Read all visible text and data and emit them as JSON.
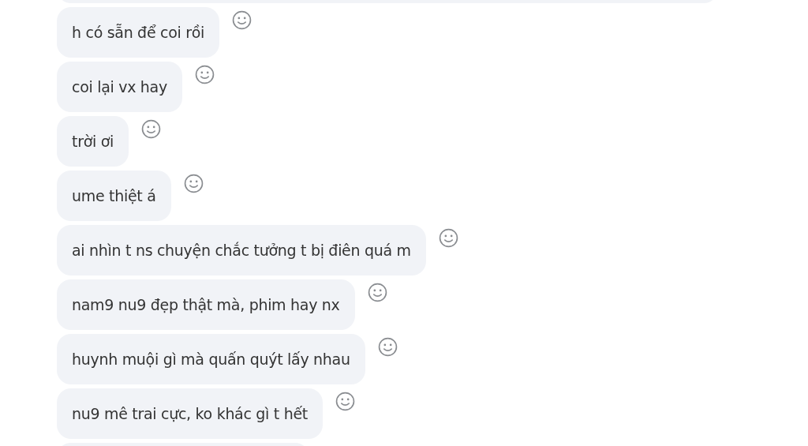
{
  "messages": [
    {
      "text": "h có sẵn để coi rồi"
    },
    {
      "text": "coi lại vx hay"
    },
    {
      "text": "trời ơi"
    },
    {
      "text": "ume thiệt á"
    },
    {
      "text": "ai nhìn t ns chuyện chắc tưởng t bị điên quá m"
    },
    {
      "text": "nam9 nu9 đẹp thật mà, phim hay nx"
    },
    {
      "text": "huynh muội gì mà quấn quýt lấy nhau"
    },
    {
      "text": "nu9 mê trai cực, ko khác gì t hết"
    }
  ]
}
